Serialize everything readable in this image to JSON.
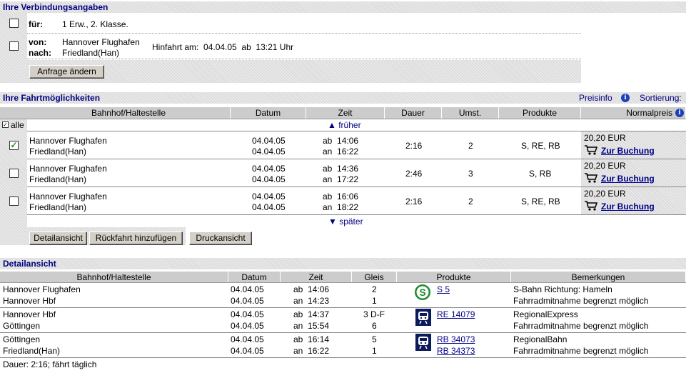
{
  "connection": {
    "title": "Ihre Verbindungsangaben",
    "fuer_label": "für:",
    "fuer_value": "1 Erw., 2. Klasse.",
    "von_label": "von:",
    "nach_label": "nach:",
    "von_value": "Hannover Flughafen",
    "nach_value": "Friedland(Han)",
    "hinfahrt": "Hinfahrt am:  04.04.05  ab  13:21 Uhr",
    "change_button": "Anfrage ändern"
  },
  "options": {
    "title": "Ihre Fahrtmöglichkeiten",
    "preisinfo": "Preisinfo",
    "sortierung": "Sortierung:",
    "headers": [
      "Bahnhof/Haltestelle",
      "Datum",
      "Zeit",
      "Dauer",
      "Umst.",
      "Produkte",
      "Normalpreis"
    ],
    "all_label": "alle",
    "earlier": "▲ früher",
    "later": "▼ später",
    "rows": [
      {
        "from": "Hannover Flughafen",
        "to": "Friedland(Han)",
        "date1": "04.04.05",
        "date2": "04.04.05",
        "dep": "ab  14:06",
        "arr": "an  16:22",
        "duration": "2:16",
        "changes": "2",
        "products": "S, RE, RB",
        "price": "20,20 EUR",
        "booking": "Zur Buchung",
        "checked": true
      },
      {
        "from": "Hannover Flughafen",
        "to": "Friedland(Han)",
        "date1": "04.04.05",
        "date2": "04.04.05",
        "dep": "ab  14:36",
        "arr": "an  17:22",
        "duration": "2:46",
        "changes": "3",
        "products": "S, RB",
        "price": "20,20 EUR",
        "booking": "Zur Buchung",
        "checked": false
      },
      {
        "from": "Hannover Flughafen",
        "to": "Friedland(Han)",
        "date1": "04.04.05",
        "date2": "04.04.05",
        "dep": "ab  16:06",
        "arr": "an  18:22",
        "duration": "2:16",
        "changes": "2",
        "products": "S, RE, RB",
        "price": "20,20 EUR",
        "booking": "Zur Buchung",
        "checked": false
      }
    ],
    "buttons": {
      "detail": "Detailansicht",
      "return": "Rückfahrt hinzufügen",
      "print": "Druckansicht"
    }
  },
  "detail": {
    "title": "Detailansicht",
    "headers": [
      "Bahnhof/Haltestelle",
      "Datum",
      "Zeit",
      "Gleis",
      "Produkte",
      "Bemerkungen"
    ],
    "legs": [
      {
        "stop1": "Hannover Flughafen",
        "stop2": "Hannover Hbf",
        "date1": "04.04.05",
        "date2": "04.04.05",
        "t1": "ab  14:06",
        "t2": "an  14:23",
        "g1": "2",
        "g2": "1",
        "icon": "sbahn-icon",
        "product": "S 5",
        "product2": "",
        "rem1": "S-Bahn Richtung: Hameln",
        "rem2": "Fahrradmitnahme begrenzt möglich"
      },
      {
        "stop1": "Hannover Hbf",
        "stop2": "Göttingen",
        "date1": "04.04.05",
        "date2": "04.04.05",
        "t1": "ab  14:37",
        "t2": "an  15:54",
        "g1": "3 D-F",
        "g2": "6",
        "icon": "train-icon",
        "product": "RE 14079",
        "product2": "",
        "rem1": "RegionalExpress",
        "rem2": "Fahrradmitnahme begrenzt möglich"
      },
      {
        "stop1": "Göttingen",
        "stop2": "Friedland(Han)",
        "date1": "04.04.05",
        "date2": "04.04.05",
        "t1": "ab  16:14",
        "t2": "an  16:22",
        "g1": "5",
        "g2": "1",
        "icon": "train-icon",
        "product": "RB 34073",
        "product2": "RB 34373",
        "rem1": "RegionalBahn",
        "rem2": "Fahrradmitnahme begrenzt möglich"
      }
    ],
    "footer": "Dauer: 2:16; fährt täglich"
  }
}
